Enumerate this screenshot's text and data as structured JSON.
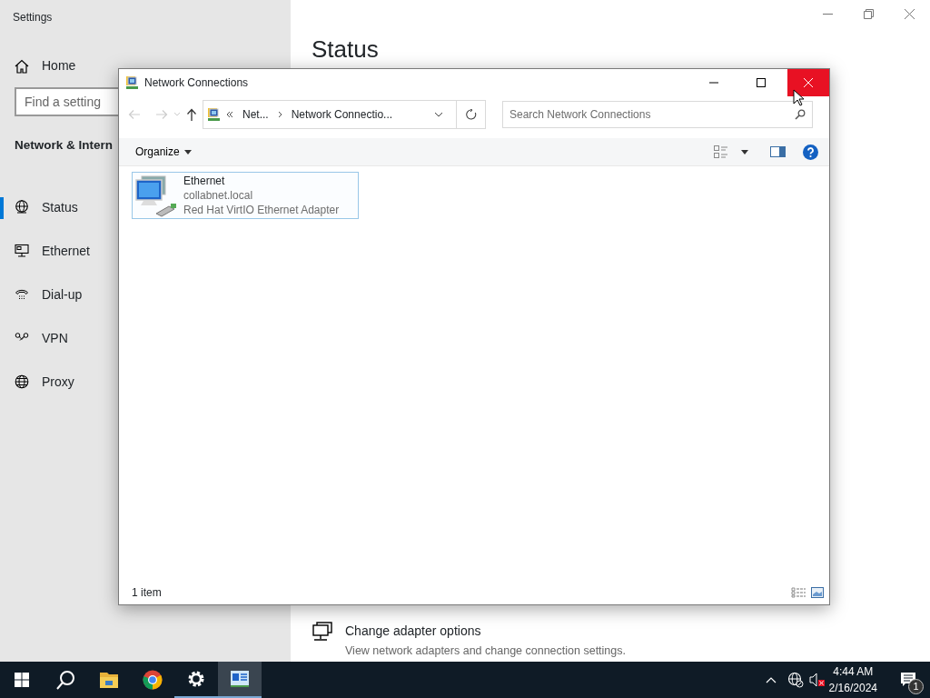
{
  "settings": {
    "title": "Settings",
    "home": "Home",
    "search": {
      "placeholder": "Find a setting"
    },
    "section_title": "Network & Intern",
    "items": [
      {
        "kind": "status",
        "label": "Status",
        "selected": true
      },
      {
        "kind": "ethernet",
        "label": "Ethernet",
        "selected": false
      },
      {
        "kind": "dialup",
        "label": "Dial-up",
        "selected": false
      },
      {
        "kind": "vpn",
        "label": "VPN",
        "selected": false
      },
      {
        "kind": "proxy",
        "label": "Proxy",
        "selected": false
      }
    ],
    "heading": "Status",
    "link": {
      "title": "Change adapter options",
      "description": "View network adapters and change connection settings."
    }
  },
  "explorer": {
    "title": "Network Connections",
    "address": [
      "Net...",
      "Network Connectio..."
    ],
    "search": {
      "placeholder": "Search Network Connections"
    },
    "organize": "Organize",
    "items": [
      {
        "name": "Ethernet",
        "domain": "collabnet.local",
        "adapter": "Red Hat VirtIO Ethernet Adapter",
        "selected": true
      }
    ],
    "status": "1 item"
  },
  "taskbar": {
    "apps": [
      {
        "kind": "folder",
        "running": false,
        "active": false
      },
      {
        "kind": "browser",
        "running": false,
        "active": false
      },
      {
        "kind": "gear",
        "running": true,
        "active": false
      },
      {
        "kind": "network",
        "running": true,
        "active": true
      }
    ],
    "volume_muted": true,
    "time": "4:44 AM",
    "date": "2/16/2024",
    "notifications": "1"
  }
}
